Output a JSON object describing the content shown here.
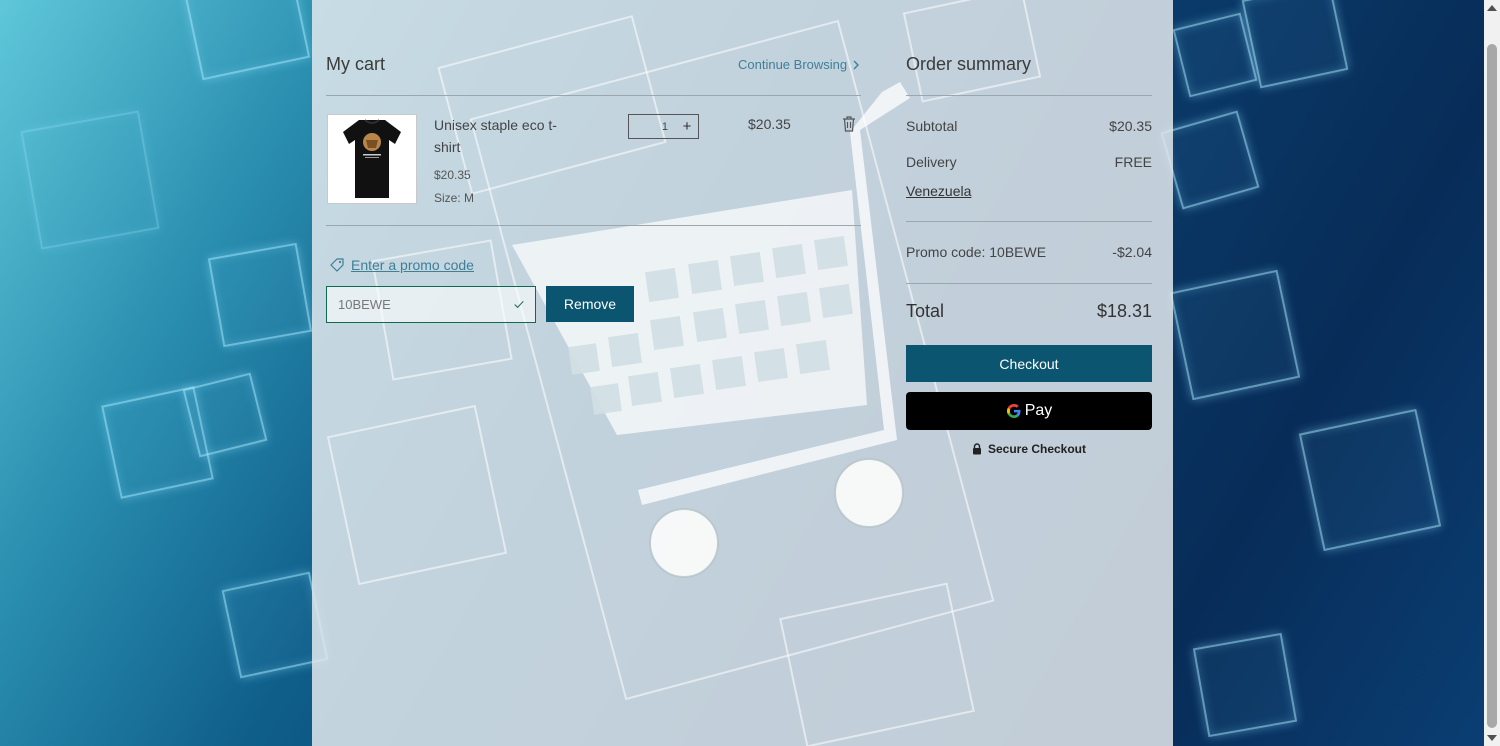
{
  "cart": {
    "title": "My cart",
    "continue_label": "Continue Browsing",
    "item": {
      "name": "Unisex staple eco t-shirt",
      "unit_price": "$20.35",
      "size": "Size: M",
      "quantity": "1",
      "line_price": "$20.35"
    },
    "promo": {
      "link_label": "Enter a promo code",
      "value": "10BEWE",
      "remove_label": "Remove"
    }
  },
  "summary": {
    "title": "Order summary",
    "subtotal_label": "Subtotal",
    "subtotal_value": "$20.35",
    "delivery_label": "Delivery",
    "delivery_value": "FREE",
    "country": "Venezuela",
    "promo_label": "Promo code: 10BEWE",
    "promo_value": "-$2.04",
    "total_label": "Total",
    "total_value": "$18.31",
    "checkout_label": "Checkout",
    "gpay_label": "Pay",
    "secure_label": "Secure Checkout"
  },
  "colors": {
    "accent": "#0c5570",
    "link": "#3f7f97",
    "promo_border": "#0f6b4f"
  },
  "icons": [
    "chevron-right-icon",
    "trash-icon",
    "plus-icon",
    "tag-icon",
    "check-icon",
    "lock-icon",
    "google-g-icon"
  ]
}
